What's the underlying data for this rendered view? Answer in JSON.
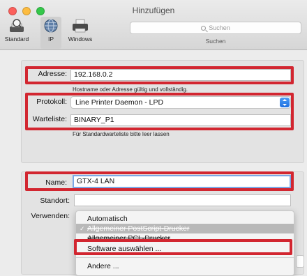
{
  "window": {
    "title": "Hinzufügen"
  },
  "toolbar": {
    "items": [
      {
        "label": "Standard",
        "icon": "magnifier-printer-icon"
      },
      {
        "label": "IP",
        "icon": "globe-icon",
        "selected": true
      },
      {
        "label": "Windows",
        "icon": "printer-icon"
      }
    ],
    "search": {
      "placeholder": "Suchen",
      "caption": "Suchen"
    }
  },
  "form": {
    "adresse": {
      "label": "Adresse:",
      "value": "192.168.0.2",
      "hint": "Hostname oder Adresse gültig und vollständig."
    },
    "protokoll": {
      "label": "Protokoll:",
      "value": "Line Printer Daemon - LPD"
    },
    "warteliste": {
      "label": "Warteliste:",
      "value": "BINARY_P1",
      "hint": "Für Standardwarteliste bitte leer lassen"
    },
    "name": {
      "label": "Name:",
      "value": "GTX-4 LAN"
    },
    "standort": {
      "label": "Standort:",
      "value": ""
    },
    "verwenden": {
      "label": "Verwenden:"
    }
  },
  "popup_menu": {
    "items": [
      {
        "label": "Automatisch",
        "state": "normal"
      },
      {
        "label": "Allgemeiner PostScript-Drucker",
        "state": "selected",
        "checked": true
      },
      {
        "label": "Allgemeiner PCL-Drucker",
        "state": "strike"
      },
      {
        "label": "Software auswählen ...",
        "state": "normal"
      },
      {
        "label": "Andere ...",
        "state": "normal"
      }
    ]
  },
  "colors": {
    "highlight_box": "#d22630",
    "accent": "#1f6fe0"
  }
}
